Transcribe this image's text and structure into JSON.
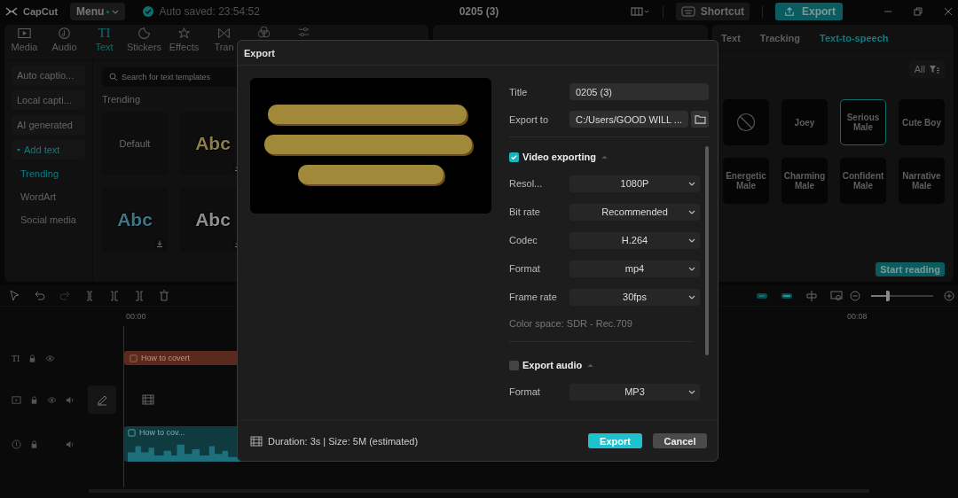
{
  "app": {
    "logo": "CapCut",
    "menu": "Menu",
    "autosave": "Auto saved: 23:54:52",
    "project_title": "0205 (3)",
    "shortcut": "Shortcut",
    "export": "Export"
  },
  "toolbar_tabs": [
    {
      "label": "Media",
      "selected": false
    },
    {
      "label": "Audio",
      "selected": false
    },
    {
      "label": "Text",
      "glyph": "TI",
      "selected": true
    },
    {
      "label": "Stickers",
      "selected": false
    },
    {
      "label": "Effects",
      "selected": false
    },
    {
      "label": "Tran",
      "selected": false
    },
    {
      "selected": false
    },
    {
      "selected": false
    }
  ],
  "text_panel": {
    "sidebar": [
      {
        "label": "Auto captio...",
        "kind": "button"
      },
      {
        "label": "Local capti...",
        "kind": "button"
      },
      {
        "label": "AI generated",
        "kind": "button"
      },
      {
        "label": "Add text",
        "kind": "group",
        "expanded": true,
        "children": [
          {
            "label": "Trending",
            "selected": true
          },
          {
            "label": "WordArt",
            "selected": false
          },
          {
            "label": "Social media",
            "selected": false
          }
        ]
      }
    ],
    "search": {
      "placeholder": "Search for text templates"
    },
    "section": "Trending",
    "templates": [
      {
        "label": "Default",
        "kind": "plain",
        "download": false
      },
      {
        "label": "Abc",
        "kind": "styled",
        "color": "#8c7c4c",
        "download": true
      },
      {
        "label": "Abc",
        "kind": "styled",
        "color": "#3e7484",
        "download": true
      },
      {
        "label": "Abc",
        "kind": "styled",
        "color": "#8e8e8e",
        "download": true
      }
    ]
  },
  "right_panel": {
    "tabs": [
      {
        "label": "Text",
        "selected": false
      },
      {
        "label": "Tracking",
        "selected": false
      },
      {
        "label": "Text-to-speech",
        "selected": true
      }
    ],
    "filter": "All",
    "voices": [
      {
        "kind": "none",
        "selected": false
      },
      {
        "kind": "voice",
        "label": "Joey",
        "selected": false
      },
      {
        "kind": "voice",
        "label": "Serious Male",
        "selected": true
      },
      {
        "kind": "voice",
        "label": "Cute Boy",
        "selected": false
      },
      {
        "kind": "voice",
        "label": "Energetic Male",
        "selected": false
      },
      {
        "kind": "voice",
        "label": "Charming Male",
        "selected": false
      },
      {
        "kind": "voice",
        "label": "Confident Male",
        "selected": false
      },
      {
        "kind": "voice",
        "label": "Narrative Male",
        "selected": false
      }
    ],
    "start_button": "Start reading"
  },
  "timeline": {
    "ruler": [
      "00:00",
      "00:08"
    ],
    "zoom": {
      "level": 0.3
    },
    "tracks": [
      {
        "kind": "text",
        "glyph": "TI",
        "clip": "How to covert"
      },
      {
        "kind": "video",
        "cover": true
      },
      {
        "kind": "audio",
        "clip": "How to cov..."
      }
    ]
  },
  "export_dialog": {
    "title": "Export",
    "fields": [
      {
        "label": "Title",
        "value": "0205 (3)",
        "kind": "text"
      },
      {
        "label": "Export to",
        "value": "C:/Users/GOOD WILL ...",
        "kind": "path"
      }
    ],
    "video": {
      "label": "Video exporting",
      "checked": true,
      "expanded": true,
      "settings": [
        {
          "label": "Resol...",
          "value": "1080P"
        },
        {
          "label": "Bit rate",
          "value": "Recommended"
        },
        {
          "label": "Codec",
          "value": "H.264"
        },
        {
          "label": "Format",
          "value": "mp4"
        },
        {
          "label": "Frame rate",
          "value": "30fps"
        }
      ],
      "note": "Color space: SDR - Rec.709"
    },
    "audio": {
      "label": "Export audio",
      "checked": false,
      "expanded": true,
      "settings": [
        {
          "label": "Format",
          "value": "MP3"
        }
      ]
    },
    "footer": "Duration: 3s | Size: 5M (estimated)",
    "buttons": [
      {
        "label": "Export",
        "kind": "primary"
      },
      {
        "label": "Cancel",
        "kind": "secondary"
      }
    ]
  }
}
